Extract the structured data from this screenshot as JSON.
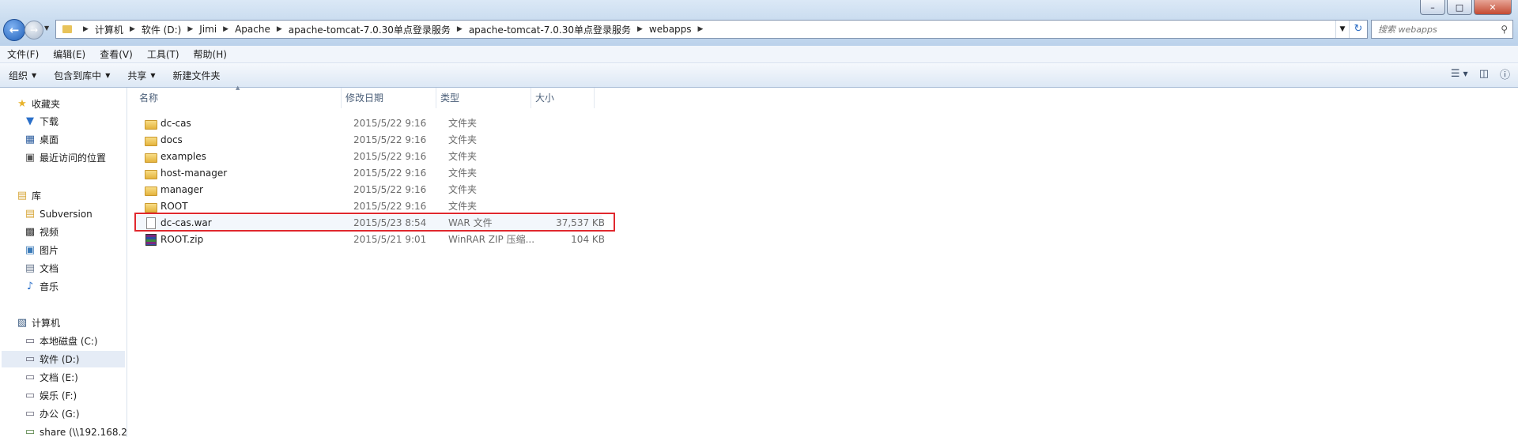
{
  "address": {
    "crumbs": [
      "计算机",
      "软件 (D:)",
      "Jimi",
      "Apache",
      "apache-tomcat-7.0.30单点登录服务",
      "apache-tomcat-7.0.30单点登录服务",
      "webapps"
    ]
  },
  "search": {
    "placeholder": "搜索 webapps"
  },
  "menu": [
    "文件(F)",
    "编辑(E)",
    "查看(V)",
    "工具(T)",
    "帮助(H)"
  ],
  "commands": {
    "organize": "组织",
    "include_library": "包含到库中",
    "share": "共享",
    "new_folder": "新建文件夹"
  },
  "nav": {
    "favorites": "收藏夹",
    "downloads": "下载",
    "desktop": "桌面",
    "recent": "最近访问的位置",
    "libraries": "库",
    "subversion": "Subversion",
    "videos": "视频",
    "pictures": "图片",
    "documents": "文档",
    "music": "音乐",
    "computer": "计算机",
    "drive_c": "本地磁盘 (C:)",
    "drive_d": "软件 (D:)",
    "drive_e": "文档 (E:)",
    "drive_f": "娱乐 (F:)",
    "drive_g": "办公 (G:)",
    "share": "share (\\\\192.168.2"
  },
  "columns": {
    "name": "名称",
    "modified": "修改日期",
    "type": "类型",
    "size": "大小"
  },
  "files": [
    {
      "name": "dc-cas",
      "modified": "2015/5/22 9:16",
      "type": "文件夹",
      "size": "",
      "icon": "folder-icon"
    },
    {
      "name": "docs",
      "modified": "2015/5/22 9:16",
      "type": "文件夹",
      "size": "",
      "icon": "folder-icon"
    },
    {
      "name": "examples",
      "modified": "2015/5/22 9:16",
      "type": "文件夹",
      "size": "",
      "icon": "folder-icon"
    },
    {
      "name": "host-manager",
      "modified": "2015/5/22 9:16",
      "type": "文件夹",
      "size": "",
      "icon": "folder-icon"
    },
    {
      "name": "manager",
      "modified": "2015/5/22 9:16",
      "type": "文件夹",
      "size": "",
      "icon": "folder-icon"
    },
    {
      "name": "ROOT",
      "modified": "2015/5/22 9:16",
      "type": "文件夹",
      "size": "",
      "icon": "folder-icon"
    },
    {
      "name": "dc-cas.war",
      "modified": "2015/5/23 8:54",
      "type": "WAR 文件",
      "size": "37,537 KB",
      "icon": "file-icon"
    },
    {
      "name": "ROOT.zip",
      "modified": "2015/5/21 9:01",
      "type": "WinRAR ZIP 压缩...",
      "size": "104 KB",
      "icon": "zip-icon"
    }
  ],
  "accent": {
    "highlight": "#e0282e",
    "selection": "#e5ecf6"
  }
}
